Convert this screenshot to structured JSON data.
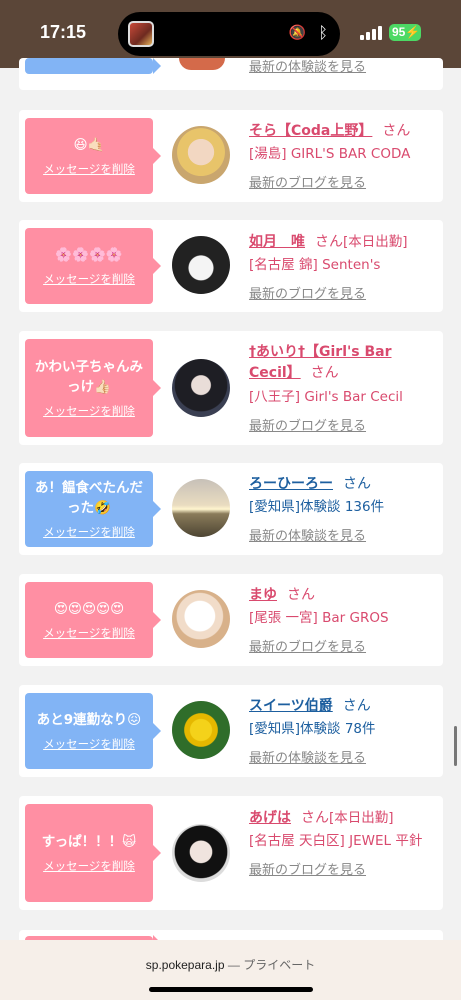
{
  "status": {
    "time": "17:15",
    "battery": "95",
    "mute_icon": "bell-slash",
    "bluetooth_icon": "bluetooth"
  },
  "browser": {
    "domain": "sp.pokepara.jp",
    "mode": "— プライベート"
  },
  "colors": {
    "pink_name": "#d94a6e",
    "blue_name": "#1d5f9f",
    "pink_bubble": "#ff8fa3",
    "blue_bubble": "#82b4f5"
  },
  "top_partial": {
    "link": "最新の体験談を見る"
  },
  "delete_label": "メッセージを削除",
  "san": "さん",
  "items": [
    {
      "msg": "😆🤙🏻",
      "name": "そら【Coda上野】",
      "tag": "",
      "shop": "[湯島] GIRL'S BAR CODA",
      "link": "最新のブログを見る"
    },
    {
      "msg": "🌸🌸🌸🌸",
      "name": "如月　唯",
      "tag": "[本日出勤]",
      "shop": "[名古屋 錦] Senten's",
      "link": "最新のブログを見る"
    },
    {
      "msg": "かわい子ちゃんみっけ👍🏻",
      "name": "†あいり†【Girl's Bar Cecil】",
      "tag": "",
      "shop": "[八王子] Girl's Bar Cecil",
      "link": "最新のブログを見る"
    },
    {
      "msg": "あ！饂食べたんだった🤣",
      "name": "ろーひーろー",
      "tag": "",
      "shop": "[愛知県]体験談 136件",
      "link": "最新の体験談を見る"
    },
    {
      "msg": "😍😍😍😍😍",
      "name": "まゆ",
      "tag": "",
      "shop": "[尾張 一宮] Bar GROS",
      "link": "最新のブログを見る"
    },
    {
      "msg": "あと9連勤なり😖",
      "name": "スイーツ伯爵",
      "tag": "",
      "shop": "[愛知県]体験談 78件",
      "link": "最新の体験談を見る"
    },
    {
      "msg": "すっぱ！！！🙀",
      "name": "あげは",
      "tag": "[本日出勤]",
      "shop": "[名古屋 天白区] JEWEL 平針",
      "link": "最新のブログを見る"
    }
  ]
}
